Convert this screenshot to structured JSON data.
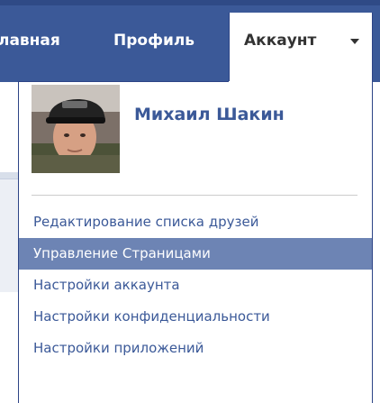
{
  "nav": {
    "home_label": "лавная",
    "profile_label": "Профиль",
    "account_label": "Аккаунт"
  },
  "profile": {
    "name": "Михаил Шакин"
  },
  "menu": {
    "items": [
      {
        "label": "Редактирование списка друзей",
        "selected": false
      },
      {
        "label": "Управление Страницами",
        "selected": true
      },
      {
        "label": "Настройки аккаунта",
        "selected": false
      },
      {
        "label": "Настройки конфиденциальности",
        "selected": false
      },
      {
        "label": "Настройки приложений",
        "selected": false
      }
    ]
  },
  "colors": {
    "topbar": "#3b5998",
    "link": "#3b5998",
    "highlight": "#6d84b4",
    "highlight_text": "#ffffff"
  },
  "icons": {
    "account_dropdown": "caret-down-icon",
    "avatar": "profile-photo"
  }
}
